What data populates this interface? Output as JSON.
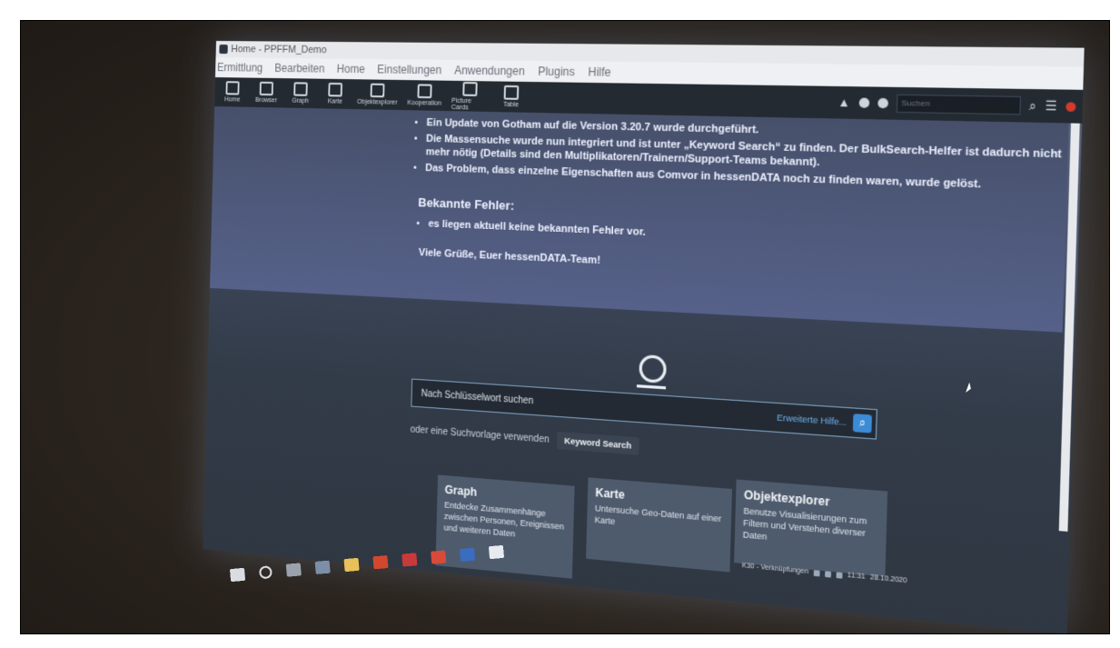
{
  "window": {
    "title": "Home - PPFFM_Demo"
  },
  "menu": [
    "Ermittlung",
    "Bearbeiten",
    "Home",
    "Einstellungen",
    "Anwendungen",
    "Plugins",
    "Hilfe"
  ],
  "toolbar": {
    "tools": [
      "Home",
      "Browser",
      "Graph",
      "Karte",
      "Objektexplorer",
      "Kooperation",
      "Picture Cards",
      "Table"
    ],
    "search_placeholder": "Suchen"
  },
  "news": {
    "items": [
      "Ein Update von Gotham auf die Version 3.20.7 wurde durchgeführt.",
      "Die Massensuche wurde nun integriert und ist unter „Keyword Search“ zu finden. Der BulkSearch-Helfer ist dadurch nicht mehr nötig (Details sind den Multiplikatoren/Trainern/Support-Teams bekannt).",
      "Das Problem, dass einzelne Eigenschaften aus Comvor in hessenDATA noch zu finden waren, wurde gelöst."
    ],
    "known_heading": "Bekannte Fehler:",
    "known_items": [
      "es liegen aktuell keine bekannten Fehler vor."
    ],
    "greeting": "Viele Grüße, Euer hessenDATA-Team!"
  },
  "search": {
    "placeholder": "Nach Schlüsselwort suchen",
    "help_link": "Erweiterte Hilfe...",
    "template_text": "oder eine Suchvorlage verwenden",
    "keyword_button": "Keyword Search"
  },
  "cards": [
    {
      "title": "Graph",
      "desc": "Entdecke Zusammenhänge zwischen Personen, Ereignissen und weiteren Daten"
    },
    {
      "title": "Karte",
      "desc": "Untersuche Geo-Daten auf einer Karte"
    },
    {
      "title": "Objektexplorer",
      "desc": "Benutze Visualisierungen zum Filtern und Verstehen diverser Daten"
    }
  ],
  "tray": {
    "label": "K30 - Verknüpfungen",
    "time": "11:31",
    "date": "28.10.2020"
  }
}
